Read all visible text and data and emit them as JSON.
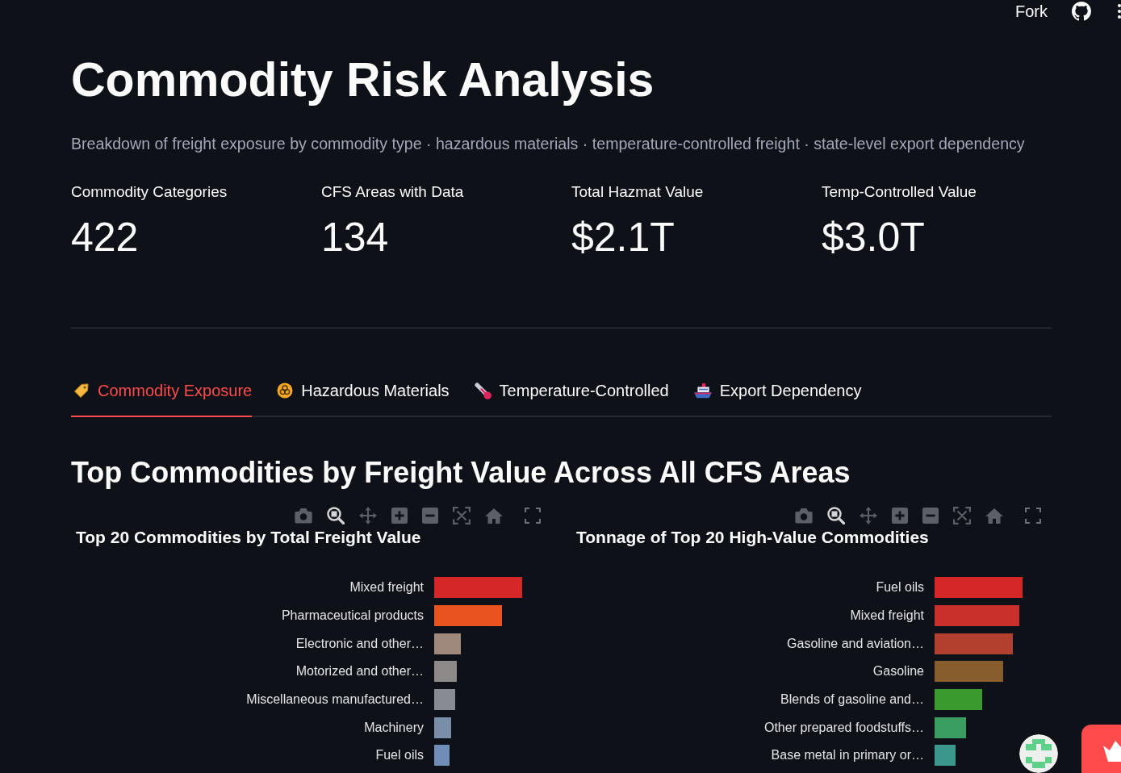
{
  "header": {
    "link": "Fork"
  },
  "title": "Commodity Risk Analysis",
  "subtitle": "Breakdown of freight exposure by commodity type · hazardous materials · temperature-controlled freight · state-level export dependency",
  "metrics": [
    {
      "label": "Commodity Categories",
      "value": "422"
    },
    {
      "label": "CFS Areas with Data",
      "value": "134"
    },
    {
      "label": "Total Hazmat Value",
      "value": "$2.1T"
    },
    {
      "label": "Temp-Controlled Value",
      "value": "$3.0T"
    }
  ],
  "tabs": [
    {
      "label": "Commodity Exposure",
      "selected": true
    },
    {
      "label": "Hazardous Materials",
      "selected": false
    },
    {
      "label": "Temperature-Controlled",
      "selected": false
    },
    {
      "label": "Export Dependency",
      "selected": false
    }
  ],
  "section_title": "Top Commodities by Freight Value Across All CFS Areas",
  "charts": [
    {
      "title": "Top 20 Commodities by Total Freight Value",
      "toolbar": [
        {
          "selected": false
        },
        {
          "selected": true
        },
        {
          "selected": false
        },
        {
          "selected": false
        },
        {
          "selected": false
        },
        {
          "selected": false
        },
        {
          "selected": false
        }
      ],
      "bars": [
        {
          "label": "Mixed freight",
          "color": "#d62728"
        },
        {
          "label": "Pharmaceutical products",
          "color": "#e8531f"
        },
        {
          "label": "Electronic and other…",
          "color": "#9e897c"
        },
        {
          "label": "Motorized and other…",
          "color": "#8e8a8a"
        },
        {
          "label": "Miscellaneous manufactured…",
          "color": "#888a94"
        },
        {
          "label": "Machinery",
          "color": "#7a8ea9"
        },
        {
          "label": "Fuel oils",
          "color": "#6f8db6"
        }
      ]
    },
    {
      "title": "Tonnage of Top 20 High-Value Commodities",
      "toolbar": [
        {
          "selected": false
        },
        {
          "selected": true
        },
        {
          "selected": false
        },
        {
          "selected": false
        },
        {
          "selected": false
        },
        {
          "selected": false
        },
        {
          "selected": false
        }
      ],
      "bars": [
        {
          "label": "Fuel oils",
          "color": "#d62728"
        },
        {
          "label": "Mixed freight",
          "color": "#c8302c"
        },
        {
          "label": "Gasoline and aviation…",
          "color": "#b2402e"
        },
        {
          "label": "Gasoline",
          "color": "#875d2e"
        },
        {
          "label": "Blends of gasoline and…",
          "color": "#3a9a2e"
        },
        {
          "label": "Other prepared foodstuffs…",
          "color": "#3a9e62"
        },
        {
          "label": "Base metal in primary or…",
          "color": "#3b978c"
        }
      ]
    }
  ]
}
